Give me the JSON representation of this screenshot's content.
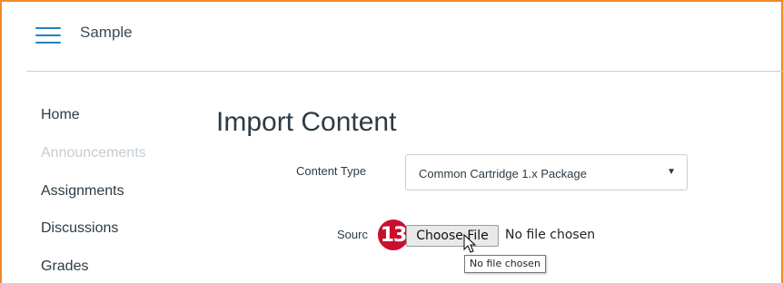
{
  "header": {
    "menu_icon": "hamburger-menu-icon",
    "course_name": "Sample"
  },
  "sidebar": {
    "items": [
      {
        "label": "Home",
        "enabled": true
      },
      {
        "label": "Announcements",
        "enabled": false
      },
      {
        "label": "Assignments",
        "enabled": true
      },
      {
        "label": "Discussions",
        "enabled": true
      },
      {
        "label": "Grades",
        "enabled": true
      }
    ]
  },
  "main": {
    "title": "Import Content",
    "content_type": {
      "label": "Content Type",
      "selected": "Common Cartridge 1.x Package"
    },
    "source": {
      "label": "Sourc",
      "step_badge": "13",
      "choose_file_label": "Choose File",
      "file_status": "No file chosen",
      "tooltip": "No file chosen"
    }
  },
  "colors": {
    "frame_border": "#f0892b",
    "menu_icon": "#1d82c6",
    "step_badge": "#c8102e",
    "disabled_nav": "#c6cdd2"
  }
}
